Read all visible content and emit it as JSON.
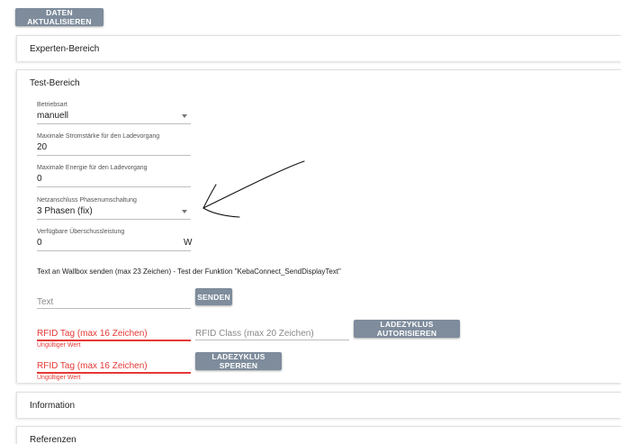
{
  "toolbar": {
    "refresh_label": "DATEN AKTUALISIEREN"
  },
  "panels": {
    "experten": "Experten-Bereich",
    "test": "Test-Bereich",
    "information": "Information",
    "referenzen": "Referenzen"
  },
  "form": {
    "betriebsart": {
      "label": "Betriebsart",
      "value": "manuell"
    },
    "stromstaerke": {
      "label": "Maximale Stromstärke für den Ladevorgang",
      "value": "20"
    },
    "energie": {
      "label": "Maximale Energie für den Ladevorgang",
      "value": "0"
    },
    "phasen": {
      "label": "Netzanschluss Phasenumschaltung",
      "value": "3 Phasen (fix)"
    },
    "ueberschuss": {
      "label": "Verfügbare Überschussleistung",
      "value": "0",
      "unit": "W"
    },
    "display_text_info": "Text an Wallbox senden (max 23 Zeichen) - Test der Funktion \"KebaConnect_SendDisplayText\"",
    "text_input": {
      "placeholder": "Text"
    },
    "send_label": "SENDEN",
    "rfid_tag_1": {
      "placeholder": "RFID Tag (max 16 Zeichen)",
      "error": "Ungültiger Wert"
    },
    "rfid_class": {
      "placeholder": "RFID Class (max 20 Zeichen)"
    },
    "authorize_label": "LADEZYKLUS AUTORISIEREN",
    "rfid_tag_2": {
      "placeholder": "RFID Tag (max 16 Zeichen)",
      "error": "Ungültiger Wert"
    },
    "block_label": "LADEZYKLUS SPERREN"
  },
  "colors": {
    "button": "#7e8c9c",
    "error": "#e53935",
    "arrow": "#111111"
  }
}
